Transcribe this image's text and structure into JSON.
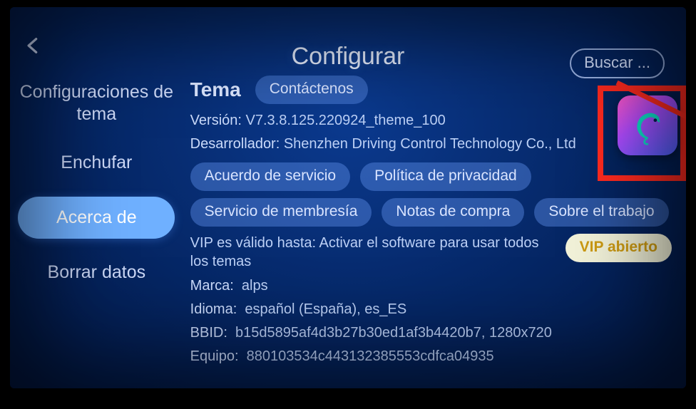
{
  "header": {
    "title": "Configurar",
    "search_label": "Buscar ..."
  },
  "sidebar": {
    "items": [
      {
        "label": "Configuraciones de tema"
      },
      {
        "label": "Enchufar"
      },
      {
        "label": "Acerca de"
      },
      {
        "label": "Borrar datos"
      }
    ],
    "active_index": 2
  },
  "main": {
    "section_label": "Tema",
    "contact_label": "Contáctenos",
    "version_label": "Versión:",
    "version_value": "V7.3.8.125.220924_theme_100",
    "developer_label": "Desarrollador:",
    "developer_value": "Shenzhen Driving Control Technology Co., Ltd",
    "pills_row1": [
      "Acuerdo de servicio",
      "Política de privacidad"
    ],
    "pills_row2": [
      "Servicio de membresía",
      "Notas de compra",
      "Sobre el trabajo"
    ],
    "vip_text": "VIP es válido hasta: Activar el software para usar todos los temas",
    "vip_button": "VIP abierto",
    "device": {
      "brand_label": "Marca:",
      "brand_value": "alps",
      "lang_label": "Idioma:",
      "lang_value": "español (España), es_ES",
      "bbid_label": "BBID:",
      "bbid_value": "b15d5895af4d3b27b30ed1af3b4420b7, 1280x720",
      "equipo_label": "Equipo:",
      "equipo_value": "880103534c443132385553cdfca04935"
    }
  },
  "annotation": {
    "highlight_color": "#ff2a1f",
    "icon_name": "chameleon-icon"
  }
}
